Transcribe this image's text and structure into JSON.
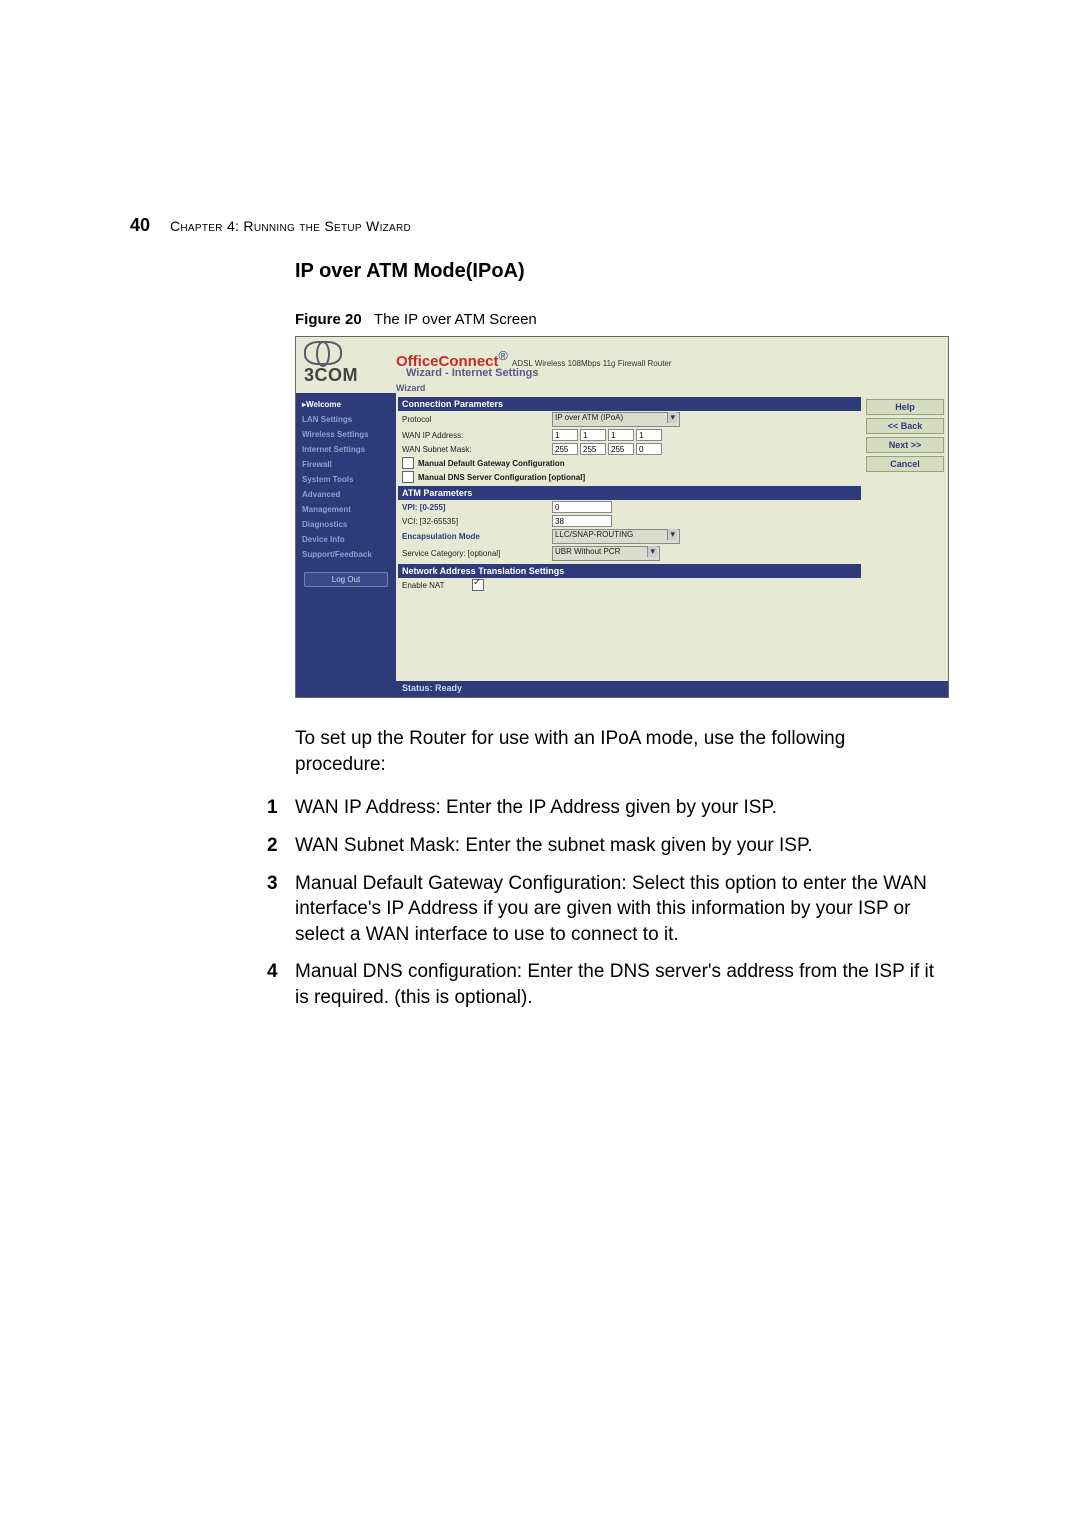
{
  "page": {
    "number": "40",
    "chapter_label": "Chapter 4: Running the Setup Wizard"
  },
  "heading": "IP over ATM Mode(IPoA)",
  "figure": {
    "label": "Figure 20",
    "caption": "The IP over ATM Screen"
  },
  "ss": {
    "brand": "3COM",
    "product_bold": "OfficeConnect",
    "product_rest": "ADSL Wireless 108Mbps 11g Firewall Router",
    "subtitle": "Wizard - Internet Settings",
    "crumb": "Wizard",
    "side": [
      "Welcome",
      "LAN Settings",
      "Wireless Settings",
      "Internet Settings",
      "Firewall",
      "System Tools",
      "Advanced",
      "Management",
      "Diagnostics",
      "Device Info",
      "Support/Feedback"
    ],
    "side_active_index": 0,
    "logout": "Log Out",
    "sec_conn": "Connection Parameters",
    "lbl_protocol": "Protocol",
    "protocol_value": "IP over ATM (IPoA)",
    "lbl_wan_ip": "WAN IP Address:",
    "wan_ip": [
      "1",
      "1",
      "1",
      "1"
    ],
    "lbl_wan_mask": "WAN Subnet Mask:",
    "wan_mask": [
      "255",
      "255",
      "255",
      "0"
    ],
    "chk_gw": "Manual Default Gateway Configuration",
    "chk_dns": "Manual DNS Server Configuration [optional]",
    "sec_atm": "ATM Parameters",
    "lbl_vpi": "VPI: [0-255]",
    "vpi_value": "0",
    "lbl_vci": "VCI: [32-65535]",
    "vci_value": "38",
    "lbl_encap": "Encapsulation Mode",
    "encap_value": "LLC/SNAP-ROUTING",
    "lbl_svc": "Service Category:  [optional]",
    "svc_value": "UBR Without PCR",
    "sec_nat": "Network Address Translation Settings",
    "lbl_nat": "Enable NAT",
    "btn_help": "Help",
    "btn_back": "<< Back",
    "btn_next": "Next >>",
    "btn_cancel": "Cancel",
    "status": "Status: Ready"
  },
  "bodytext": "To set up the Router for use with an IPoA mode, use the following procedure:",
  "steps": [
    "WAN IP Address: Enter the IP Address given by your ISP.",
    "WAN Subnet Mask: Enter the subnet mask given by your ISP.",
    "Manual Default Gateway Configuration: Select this option to enter the WAN interface's IP Address if you are given with this information by your ISP or select a WAN interface to use to connect to it.",
    "Manual DNS configuration: Enter the DNS server's address from the ISP if it is required. (this is optional)."
  ]
}
